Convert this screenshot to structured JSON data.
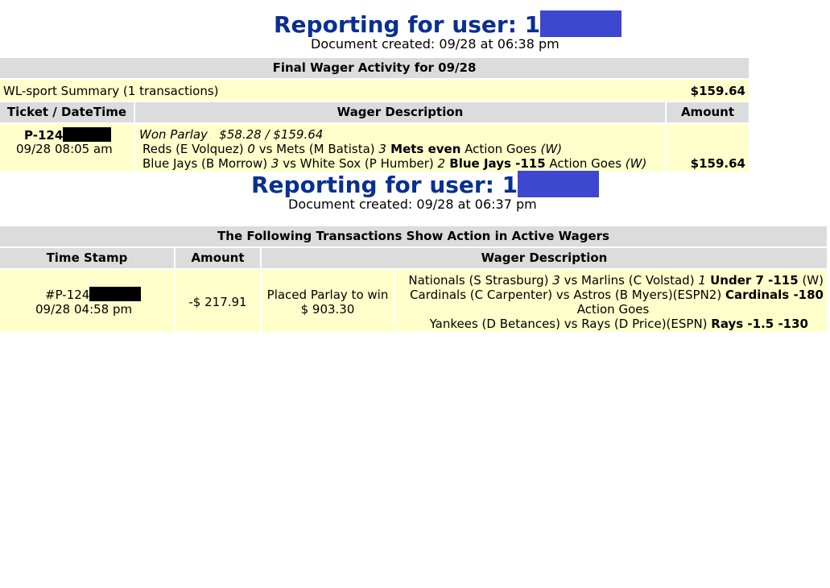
{
  "report1": {
    "title_prefix": "Reporting for user: 1",
    "doc_created": "Document created: 09/28 at 06:38 pm",
    "section_title": "Final Wager Activity for 09/28",
    "summary_label": "WL-sport Summary (1 transactions)",
    "summary_amount": "$159.64",
    "columns": [
      "Ticket / DateTime",
      "Wager Description",
      "Amount"
    ],
    "ticket_prefix": "P-124",
    "ticket_datetime": "09/28 08:05 am",
    "result_line": "Won Parlay   $58.28 / $159.64",
    "legs": [
      {
        "pre": "Reds (E Volquez) ",
        "s1": "0",
        "mid": " vs Mets (M Batista) ",
        "s2": "3",
        "pick": " Mets even",
        "tail": " Action Goes ",
        "res": "(W)"
      },
      {
        "pre": "Blue Jays (B Morrow) ",
        "s1": "3",
        "mid": " vs White Sox (P Humber) ",
        "s2": "2",
        "pick": " Blue Jays -115",
        "tail": " Action Goes ",
        "res": "(W)"
      }
    ],
    "amount": "$159.64"
  },
  "report2": {
    "title_prefix": "Reporting for user: 1",
    "doc_created": "Document created: 09/28 at 06:37 pm",
    "section_title": "The Following Transactions Show Action in Active Wagers",
    "columns": [
      "Time Stamp",
      "Amount",
      "Wager Description"
    ],
    "ticket_prefix": "#P-124",
    "timestamp": "09/28 04:58 pm",
    "amount": "-$ 217.91",
    "placed_line1": "Placed Parlay to win",
    "placed_line2": "$ 903.30",
    "leg1": {
      "pre": "Nationals (S Strasburg) ",
      "s1": "3",
      "mid": " vs Marlins (C Volstad) ",
      "s2": "1",
      "pick": " Under 7 -115",
      "tail": " (W)"
    },
    "leg2": {
      "pre": "Cardinals (C Carpenter) vs Astros (B Myers)(ESPN2) ",
      "pick": "Cardinals -180"
    },
    "leg2_line2": "Action Goes",
    "leg3": {
      "pre": "Yankees (D Betances) vs Rays (D Price)(ESPN) ",
      "pick": "Rays -1.5 -130"
    }
  },
  "colors": {
    "title_blue": "#0a2f93",
    "redact_blue": "#3d47cf",
    "header_gray": "#dcdcdc",
    "row_yellow": "#ffffcc"
  }
}
